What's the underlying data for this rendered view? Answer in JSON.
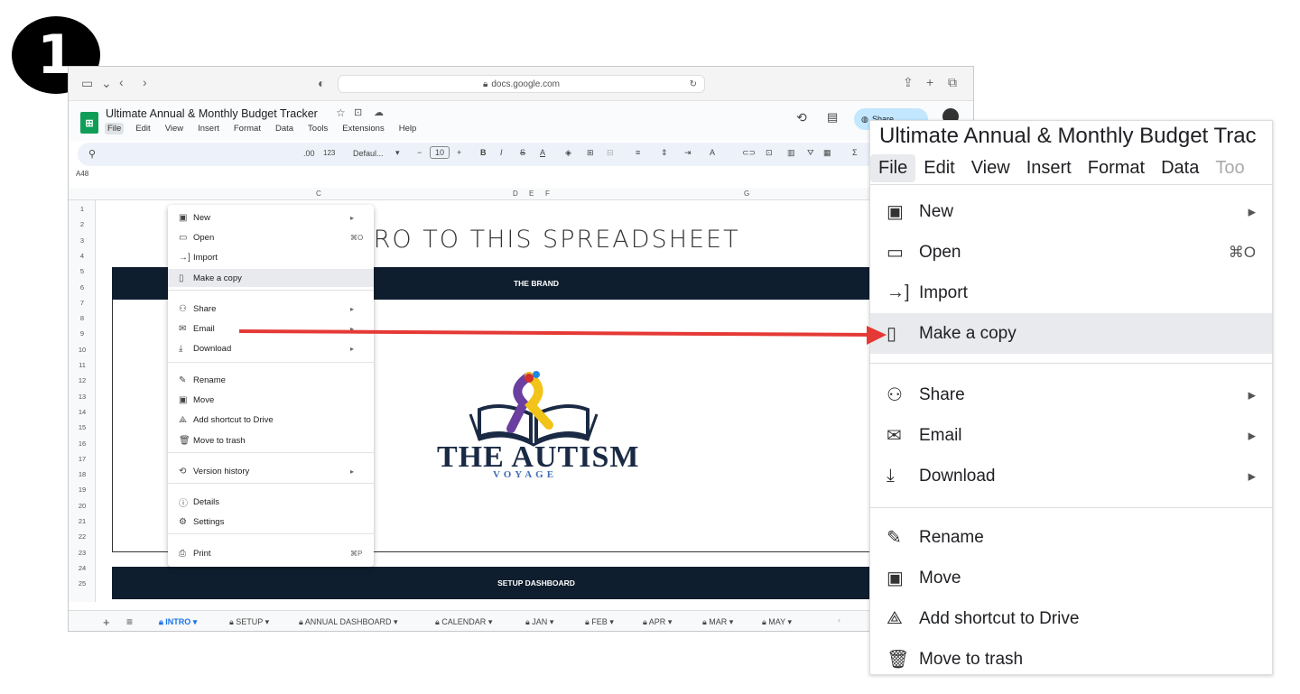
{
  "step_number": "1",
  "browser": {
    "url": "docs.google.com"
  },
  "doc": {
    "title": "Ultimate Annual & Monthly Budget Tracker",
    "menu": [
      "File",
      "Edit",
      "View",
      "Insert",
      "Format",
      "Data",
      "Tools",
      "Extensions",
      "Help"
    ],
    "share_label": "Share"
  },
  "toolbar": {
    "font": "Defaul...",
    "font_size": "10",
    "format_123": "123",
    "decimals": ".00"
  },
  "namebox": "A48",
  "columns": [
    "C",
    "D",
    "E",
    "F",
    "G"
  ],
  "rows": [
    "1",
    "2",
    "3",
    "4",
    "5",
    "6",
    "7",
    "8",
    "9",
    "10",
    "11",
    "12",
    "13",
    "14",
    "15",
    "16",
    "17",
    "18",
    "19",
    "20",
    "21",
    "22",
    "23",
    "24",
    "25"
  ],
  "sheet": {
    "intro_title": "INTRO TO THIS SPREADSHEET",
    "brand_bar": "THE BRAND",
    "setup_bar": "SETUP DASHBOARD",
    "logo_title": "THE AUTISM",
    "logo_sub": "VOYAGE"
  },
  "tabs": [
    "INTRO",
    "SETUP",
    "ANNUAL DASHBOARD",
    "CALENDAR",
    "JAN",
    "FEB",
    "APR",
    "MAR",
    "MAY"
  ],
  "file_menu": {
    "items": [
      {
        "label": "New",
        "icon": "new-icon",
        "right": "▸"
      },
      {
        "label": "Open",
        "icon": "folder-icon",
        "right": "⌘O"
      },
      {
        "label": "Import",
        "icon": "import-icon",
        "right": ""
      },
      {
        "label": "Make a copy",
        "icon": "copy-icon",
        "right": ""
      },
      {
        "label": "Share",
        "icon": "share-person-icon",
        "right": "▸"
      },
      {
        "label": "Email",
        "icon": "email-icon",
        "right": "▸"
      },
      {
        "label": "Download",
        "icon": "download-icon",
        "right": "▸"
      },
      {
        "label": "Rename",
        "icon": "rename-icon",
        "right": ""
      },
      {
        "label": "Move",
        "icon": "move-icon",
        "right": ""
      },
      {
        "label": "Add shortcut to Drive",
        "icon": "drive-shortcut-icon",
        "right": ""
      },
      {
        "label": "Move to trash",
        "icon": "trash-icon",
        "right": ""
      },
      {
        "label": "Version history",
        "icon": "history-icon",
        "right": "▸"
      },
      {
        "label": "Details",
        "icon": "info-icon",
        "right": ""
      },
      {
        "label": "Settings",
        "icon": "settings-icon",
        "right": ""
      },
      {
        "label": "Print",
        "icon": "print-icon",
        "right": "⌘P"
      }
    ]
  },
  "zoom": {
    "title": "Ultimate Annual & Monthly Budget Trac",
    "menu": [
      "File",
      "Edit",
      "View",
      "Insert",
      "Format",
      "Data",
      "Too"
    ],
    "items": [
      {
        "label": "New",
        "icon": "new-icon",
        "right": "▸"
      },
      {
        "label": "Open",
        "icon": "folder-icon",
        "right": "⌘O"
      },
      {
        "label": "Import",
        "icon": "import-icon",
        "right": ""
      },
      {
        "label": "Make a copy",
        "icon": "copy-icon",
        "right": ""
      },
      {
        "label": "Share",
        "icon": "share-person-icon",
        "right": "▸"
      },
      {
        "label": "Email",
        "icon": "email-icon",
        "right": "▸"
      },
      {
        "label": "Download",
        "icon": "download-icon",
        "right": "▸"
      },
      {
        "label": "Rename",
        "icon": "rename-icon",
        "right": ""
      },
      {
        "label": "Move",
        "icon": "move-icon",
        "right": ""
      },
      {
        "label": "Add shortcut to Drive",
        "icon": "drive-shortcut-icon",
        "right": ""
      },
      {
        "label": "Move to trash",
        "icon": "trash-icon",
        "right": ""
      }
    ]
  },
  "colors": {
    "accent_arrow": "#e53935",
    "dark_bar": "#0f1e2e",
    "sheets_green": "#0f9d58"
  }
}
